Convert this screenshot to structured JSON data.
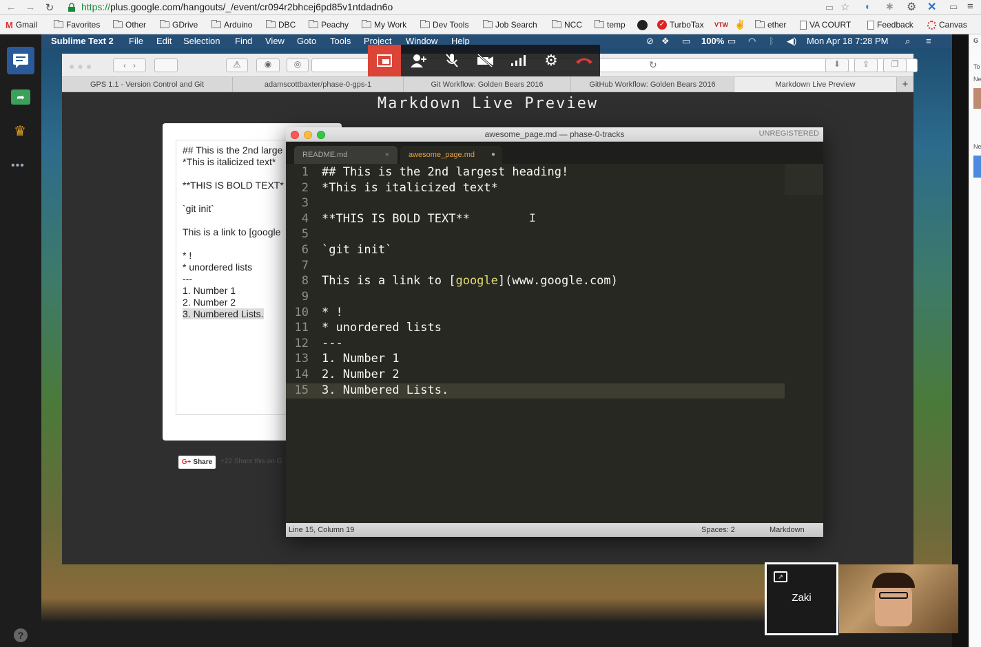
{
  "browser": {
    "url_scheme": "https://",
    "url_rest": "plus.google.com/hangouts/_/event/cr094r2bhcej6pd85v1ntdadn6o",
    "bookmarks": [
      "Gmail",
      "Favorites",
      "Other",
      "GDrive",
      "Arduino",
      "DBC",
      "Peachy",
      "My Work",
      "Dev Tools",
      "Job Search",
      "NCC",
      "temp",
      "TurboTax",
      "ether",
      "VA COURT",
      "Feedback",
      "Canvas"
    ]
  },
  "menubar": {
    "app": "Sublime Text 2",
    "items": [
      "File",
      "Edit",
      "Selection",
      "Find",
      "View",
      "Goto",
      "Tools",
      "Project",
      "Window",
      "Help"
    ],
    "battery": "100%",
    "datetime": "Mon Apr 18  7:28 PM"
  },
  "inner_browser": {
    "tabs": [
      "GPS 1.1 - Version Control and Git",
      "adamscottbaxter/phase-0-gps-1",
      "Git Workflow: Golden Bears 2016",
      "GitHub Workflow: Golden Bears 2016",
      "Markdown Live Preview"
    ],
    "page_title": "Markdown Live Preview",
    "preview_lines": [
      "## This is the 2nd large",
      "*This is italicized text*",
      "",
      "**THIS IS BOLD TEXT*",
      "",
      "`git init`",
      "",
      "This is a link to [google",
      "",
      "* !",
      "* unordered lists",
      "---",
      "1. Number 1",
      "2. Number 2",
      "3. Numbered Lists."
    ],
    "share_label": "Share",
    "share_text": "+22   Share this on G"
  },
  "sublime": {
    "window_title": "awesome_page.md — phase-0-tracks",
    "unregistered": "UNREGISTERED",
    "tabs": [
      "README.md",
      "awesome_page.md"
    ],
    "lines": [
      {
        "n": "1",
        "t": "## This is the 2nd largest heading!"
      },
      {
        "n": "2",
        "t": "*This is italicized text*"
      },
      {
        "n": "3",
        "t": ""
      },
      {
        "n": "4",
        "t": "**THIS IS BOLD TEXT**"
      },
      {
        "n": "5",
        "t": ""
      },
      {
        "n": "6",
        "t": "`git init`"
      },
      {
        "n": "7",
        "t": ""
      },
      {
        "n": "8",
        "t": "This is a link to [google](www.google.com)"
      },
      {
        "n": "9",
        "t": ""
      },
      {
        "n": "10",
        "t": "* !"
      },
      {
        "n": "11",
        "t": "* unordered lists"
      },
      {
        "n": "12",
        "t": "---"
      },
      {
        "n": "13",
        "t": "1. Number 1"
      },
      {
        "n": "14",
        "t": "2. Number 2"
      },
      {
        "n": "15",
        "t": "3. Numbered Lists."
      }
    ],
    "status_position": "Line 15, Column 19",
    "status_spaces": "Spaces: 2",
    "status_syntax": "Markdown"
  },
  "hangout": {
    "participant_name": "Zaki",
    "right_panel_labels": [
      "G",
      "To",
      "Ne",
      "Ne"
    ]
  }
}
